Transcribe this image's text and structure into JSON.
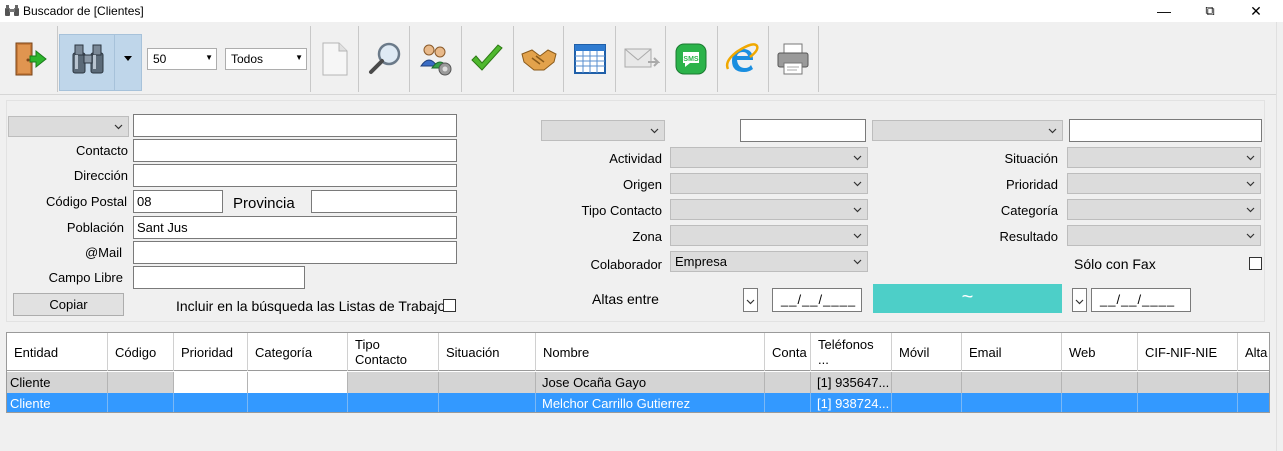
{
  "window": {
    "title": "Buscador de [Clientes]",
    "minimize": "—",
    "maximize": "⧉",
    "close": "✕"
  },
  "toolbar": {
    "limit_value": "50",
    "scope_value": "Todos",
    "icons": [
      "exit-icon",
      "binoculars-icon",
      "new-document-icon",
      "magnifier-icon",
      "users-config-icon",
      "checkmark-icon",
      "handshake-icon",
      "calendar-grid-icon",
      "email-icon",
      "sms-icon",
      "internet-explorer-icon",
      "printer-icon"
    ],
    "sms_text": "SMS"
  },
  "filters": {
    "left": {
      "field_type_value": "",
      "field_value": "",
      "contacto_label": "Contacto",
      "contacto_value": "",
      "direccion_label": "Dirección",
      "direccion_value": "",
      "codigo_postal_label": "Código Postal",
      "codigo_postal_value": "08",
      "provincia_label": "Provincia",
      "provincia_value": "",
      "poblacion_label": "Población",
      "poblacion_value": "Sant Jus",
      "mail_label": "@Mail",
      "mail_value": "",
      "campo_libre_label": "Campo Libre",
      "campo_libre_value": "",
      "copiar_label": "Copiar",
      "incluir_label": "Incluir en la búsqueda las Listas de Trabajo"
    },
    "middle": {
      "actividad_label": "Actividad",
      "origen_label": "Origen",
      "tipo_contacto_label": "Tipo Contacto",
      "zona_label": "Zona",
      "colaborador_label": "Colaborador",
      "colaborador_value": "Empresa",
      "altas_label": "Altas entre",
      "date_from": "__/__/____",
      "date_to": "__/__/____",
      "range_symbol": "~"
    },
    "right": {
      "situacion_label": "Situación",
      "prioridad_label": "Prioridad",
      "categoria_label": "Categoría",
      "resultado_label": "Resultado",
      "solo_fax_label": "Sólo con Fax"
    }
  },
  "table": {
    "columns": [
      "Entidad",
      "Código",
      "Prioridad",
      "Categoría",
      "Tipo\nContacto",
      "Situación",
      "Nombre",
      "Conta",
      "Teléfonos\n...",
      "Móvil",
      "Email",
      "Web",
      "CIF-NIF-NIE",
      "Alta"
    ],
    "rows": [
      [
        "Cliente",
        "",
        "",
        "",
        "",
        "",
        "Jose Ocaña Gayo",
        "",
        "[1] 935647...",
        "",
        "",
        "",
        "",
        ""
      ],
      [
        "Cliente",
        "",
        "",
        "",
        "",
        "",
        "Melchor Carrillo Gutierrez",
        "",
        "[1] 938724...",
        "",
        "",
        "",
        "",
        ""
      ]
    ]
  },
  "colors": {
    "selection": "#3399ff",
    "range_button": "#4dcfc8",
    "binoculars_highlight": "#bfd6ea"
  }
}
